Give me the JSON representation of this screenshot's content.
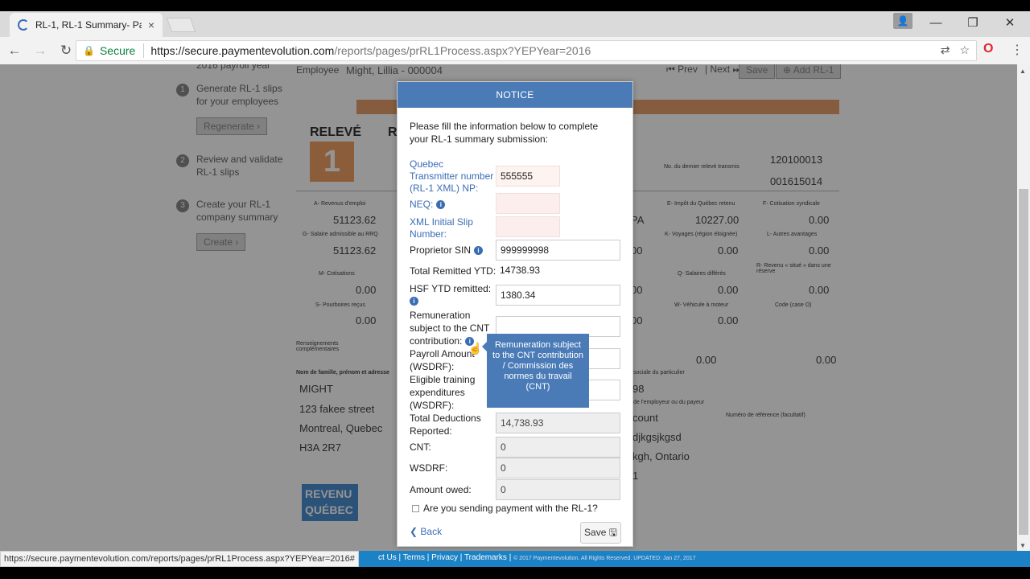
{
  "browser": {
    "tab_title": "RL-1, RL-1 Summary- Pa",
    "tab_close": "×",
    "secure_label": "Secure",
    "url_host": "https://secure.paymentevolution.com",
    "url_path": "/reports/pages/prRL1Process.aspx?YEPYear=2016",
    "status_url": "https://secure.paymentevolution.com/reports/pages/prRL1Process.aspx?YEPYear=2016#"
  },
  "background": {
    "payroll_year": "2016 payroll year",
    "employee_label": "Employee",
    "employee_value": "Might, Lillia - 000004",
    "prev": "Prev",
    "next": "Next",
    "save": "Save",
    "add_rl1": "Add RL-1",
    "steps": [
      {
        "num": "1",
        "text": "Generate RL-1 slips for your employees",
        "button": "Regenerate"
      },
      {
        "num": "2",
        "text": "Review and validate RL-1 slips"
      },
      {
        "num": "3",
        "text": "Create your RL-1 company summary",
        "button": "Create"
      }
    ],
    "releve": "RELEVÉ",
    "releve_num": "1",
    "r_letter": "R",
    "ref1": "120100013",
    "ref2": "001615014",
    "last_slip_label": "No. du dernier relevé transmis",
    "boxes": [
      {
        "label": "A- Revenus d'emploi",
        "value": "51123.62"
      },
      {
        "label": "G- Salaire admissible au RRQ",
        "value": "51123.62"
      },
      {
        "label": "M- Cotisations",
        "value": "0.00"
      },
      {
        "label": "S- Pourboires reçus",
        "value": "0.00"
      },
      {
        "label": "E- Impôt du Québec retenu",
        "value": "10227.00"
      },
      {
        "label": "F- Cotisation syndicale",
        "value": "0.00"
      },
      {
        "label": "K- Voyages (région éloignée)",
        "value": "0.00"
      },
      {
        "label": "L- Autres avantages",
        "value": "0.00"
      },
      {
        "label": "Q- Salaires différés",
        "value": "0.00"
      },
      {
        "label": "R- Revenu « situé » dans une réserve",
        "value": "0.00"
      },
      {
        "label": "W- Véhicule à moteur",
        "value": "0.00"
      },
      {
        "label": "Code (case O)",
        "value": ""
      }
    ],
    "extra_vals": [
      "0.00",
      "0.00"
    ],
    "addinfo_label": "Renseignements complémentaires",
    "name_label": "Nom de famille, prénom et adresse",
    "address": [
      "MIGHT",
      "123 fakee street",
      "Montreal, Quebec",
      "H3A 2R7"
    ],
    "sin_label": "sociale du particulier",
    "sin_value": "98",
    "employer_label": "de l'employeur ou du payeur",
    "ref_label": "Numéro de référence (facultatif)",
    "employer": [
      "count",
      "djkgsjkgsd",
      "kgh, Ontario",
      "1"
    ],
    "revenu_logo": "REVENU QUÉBEC"
  },
  "modal": {
    "title": "NOTICE",
    "intro": "Please fill the information below to complete your RL-1 summary submission:",
    "fields": [
      {
        "label": "Quebec Transmitter number (RL-1 XML) NP:",
        "value": ""
      },
      {
        "label": "NEQ:",
        "value": ""
      },
      {
        "label": "XML Initial Slip Number:",
        "value": ""
      },
      {
        "label": "Proprietor SIN",
        "value": "999999998"
      },
      {
        "label": "Total Remitted YTD:",
        "value": "14738.93"
      },
      {
        "label": "HSF YTD remitted:",
        "value": "1380.34"
      },
      {
        "label": "Remuneration subject to the CNT contribution:",
        "value": ""
      },
      {
        "label": "Payroll Amount (WSDRF):",
        "value": ""
      },
      {
        "label": "Eligible training expenditures (WSDRF):",
        "value": ""
      },
      {
        "label": "Total Deductions Reported:",
        "value": "14,738.93"
      },
      {
        "label": "CNT:",
        "value": "0"
      },
      {
        "label": "WSDRF:",
        "value": "0"
      },
      {
        "label": "Amount owed:",
        "value": "0"
      }
    ],
    "transmitter_value": "555555",
    "tooltip": "Remuneration subject to the CNT contribution / Commission des normes du travail (CNT)",
    "checkbox_label": "Are you sending payment with the RL-1?",
    "back": "Back",
    "save": "Save"
  },
  "footer": {
    "contact": "ct Us",
    "terms": "Terms",
    "privacy": "Privacy",
    "trademarks": "Trademarks",
    "copyright": "© 2017 Paymentevolution. All Rights Reserved. UPDATED: Jan 27, 2017"
  }
}
